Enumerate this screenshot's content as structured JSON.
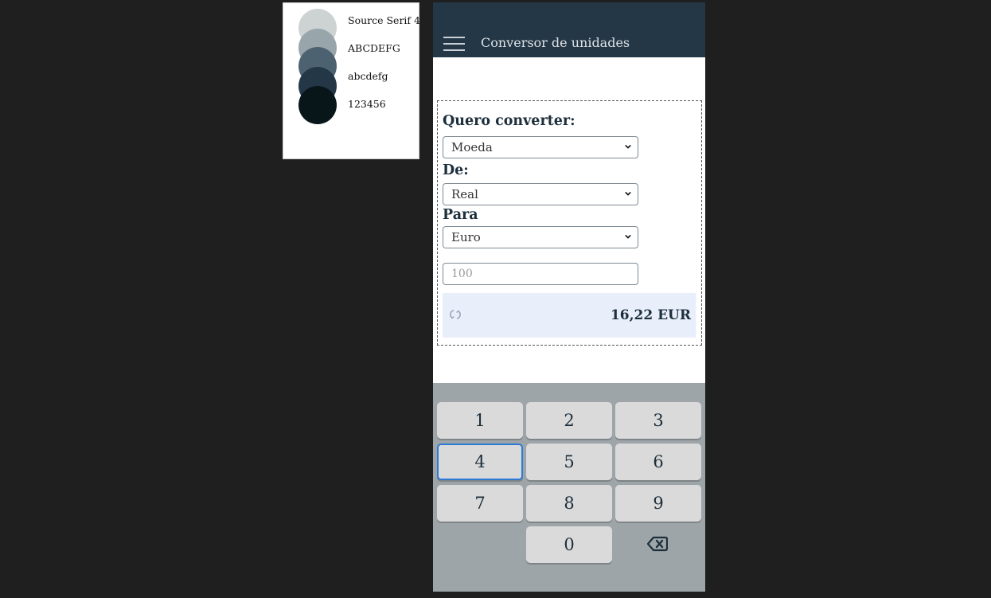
{
  "style_guide": {
    "font_name": "Source Serif 4",
    "samples": [
      "ABCDEFG",
      "abcdefg",
      "123456"
    ],
    "palette": [
      "#cdd2d3",
      "#98a5ab",
      "#4d6271",
      "#243746",
      "#081619"
    ]
  },
  "app": {
    "title": "Conversor de unidades",
    "icons": {
      "menu": "hamburger-menu-icon",
      "swap": "swap-icon",
      "backspace": "backspace-icon"
    },
    "colors": {
      "appbar": "#243746",
      "result_bg": "#e9eefb",
      "keypad_bg": "#9ea5a9",
      "focus": "#2d7bd6"
    }
  },
  "form": {
    "category_label": "Quero converter:",
    "category_value": "Moeda",
    "from_label": "De:",
    "from_value": "Real",
    "to_label": "Para",
    "to_value": "Euro",
    "amount_placeholder": "100",
    "result": "16,22 EUR"
  },
  "keypad": {
    "keys": [
      "1",
      "2",
      "3",
      "4",
      "5",
      "6",
      "7",
      "8",
      "9",
      "0"
    ],
    "focused_key": "4"
  }
}
